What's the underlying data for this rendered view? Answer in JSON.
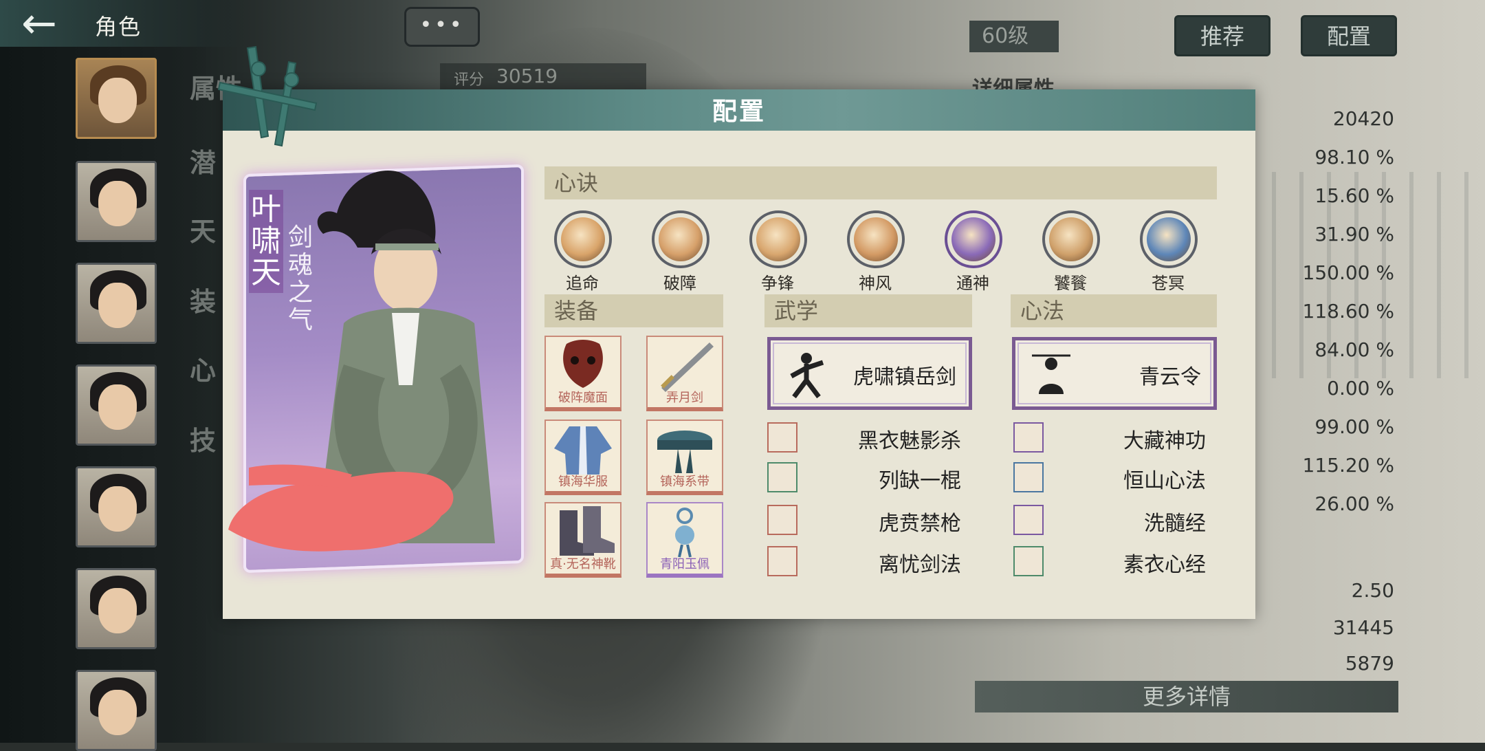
{
  "header": {
    "back_icon": "left-arrow",
    "title": "角色",
    "more_label": "•••"
  },
  "left_menu": [
    "属性",
    "潜",
    "天",
    "装",
    "心",
    "技"
  ],
  "score": {
    "label": "评分",
    "value": "30519"
  },
  "level_badge": "60级",
  "top_buttons": {
    "recommend": "推荐",
    "config": "配置"
  },
  "detail_title": "详细属性",
  "stats": [
    "20420",
    "98.10 %",
    "15.60 %",
    "31.90 %",
    "150.00 %",
    "118.60 %",
    "84.00 %",
    "0.00 %",
    "99.00 %",
    "115.20 %",
    "26.00 %",
    "2.50",
    "31445",
    "5879"
  ],
  "more_details": "更多详情",
  "modal": {
    "title": "配置",
    "character": {
      "name": "叶啸天",
      "title": "剑魂之气"
    },
    "sections": {
      "xinjue": "心诀",
      "equipment": "装备",
      "wuxue": "武学",
      "xinfa": "心法"
    },
    "xinjue_skills": [
      {
        "name": "追命",
        "color": "#d9a46a",
        "ring": "#5c6068"
      },
      {
        "name": "破障",
        "color": "#d6a06a",
        "ring": "#5c6068"
      },
      {
        "name": "争锋",
        "color": "#d8a66e",
        "ring": "#5c6068"
      },
      {
        "name": "神风",
        "color": "#d39a64",
        "ring": "#5c6068"
      },
      {
        "name": "通神",
        "color": "#8a6ab8",
        "ring": "#6a4f94"
      },
      {
        "name": "饕餮",
        "color": "#cfa06a",
        "ring": "#5c6068"
      },
      {
        "name": "苍冥",
        "color": "#5d86b8",
        "ring": "#5c6068"
      }
    ],
    "equipment": [
      {
        "name": "破阵魔面",
        "rarity": "red"
      },
      {
        "name": "弄月剑",
        "rarity": "red"
      },
      {
        "name": "镇海华服",
        "rarity": "red"
      },
      {
        "name": "镇海系带",
        "rarity": "red"
      },
      {
        "name": "真·无名神靴",
        "rarity": "red"
      },
      {
        "name": "青阳玉佩",
        "rarity": "purple"
      }
    ],
    "wuxue": {
      "main": "虎啸镇岳剑",
      "list": [
        {
          "name": "黑衣魅影杀",
          "frame": "red"
        },
        {
          "name": "列缺一棍",
          "frame": "green"
        },
        {
          "name": "虎贲禁枪",
          "frame": "red"
        },
        {
          "name": "离忧剑法",
          "frame": "red"
        }
      ]
    },
    "xinfa": {
      "main": "青云令",
      "list": [
        {
          "name": "大藏神功",
          "frame": "purple"
        },
        {
          "name": "恒山心法",
          "frame": "blue"
        },
        {
          "name": "洗髓经",
          "frame": "purple"
        },
        {
          "name": "素衣心经",
          "frame": "green"
        }
      ]
    }
  }
}
